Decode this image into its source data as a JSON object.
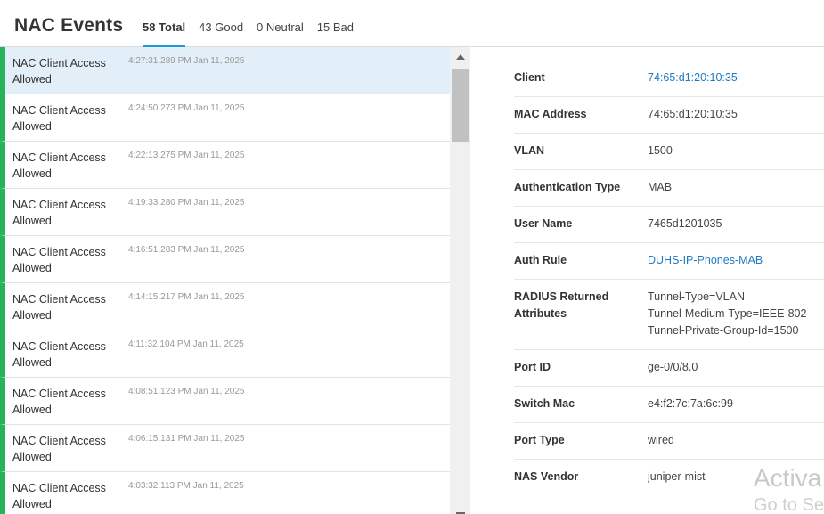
{
  "header": {
    "title": "NAC Events",
    "tabs": [
      {
        "label": "58 Total",
        "active": true
      },
      {
        "label": "43 Good",
        "active": false
      },
      {
        "label": "0 Neutral",
        "active": false
      },
      {
        "label": "15 Bad",
        "active": false
      }
    ]
  },
  "events": [
    {
      "title": "NAC Client Access Allowed",
      "time": "4:27:31.289 PM Jan 11, 2025",
      "status": "good",
      "selected": true
    },
    {
      "title": "NAC Client Access Allowed",
      "time": "4:24:50.273 PM Jan 11, 2025",
      "status": "good",
      "selected": false
    },
    {
      "title": "NAC Client Access Allowed",
      "time": "4:22:13.275 PM Jan 11, 2025",
      "status": "good",
      "selected": false
    },
    {
      "title": "NAC Client Access Allowed",
      "time": "4:19:33.280 PM Jan 11, 2025",
      "status": "good",
      "selected": false
    },
    {
      "title": "NAC Client Access Allowed",
      "time": "4:16:51.283 PM Jan 11, 2025",
      "status": "good",
      "selected": false
    },
    {
      "title": "NAC Client Access Allowed",
      "time": "4:14:15.217 PM Jan 11, 2025",
      "status": "good",
      "selected": false
    },
    {
      "title": "NAC Client Access Allowed",
      "time": "4:11:32.104 PM Jan 11, 2025",
      "status": "good",
      "selected": false
    },
    {
      "title": "NAC Client Access Allowed",
      "time": "4:08:51.123 PM Jan 11, 2025",
      "status": "good",
      "selected": false
    },
    {
      "title": "NAC Client Access Allowed",
      "time": "4:06:15.131 PM Jan 11, 2025",
      "status": "good",
      "selected": false
    },
    {
      "title": "NAC Client Access Allowed",
      "time": "4:03:32.113 PM Jan 11, 2025",
      "status": "good",
      "selected": false
    }
  ],
  "details": [
    {
      "label": "Client",
      "value": [
        "74:65:d1:20:10:35"
      ],
      "link": true
    },
    {
      "label": "MAC Address",
      "value": [
        "74:65:d1:20:10:35"
      ],
      "link": false
    },
    {
      "label": "VLAN",
      "value": [
        "1500"
      ],
      "link": false
    },
    {
      "label": "Authentication Type",
      "value": [
        "MAB"
      ],
      "link": false
    },
    {
      "label": "User Name",
      "value": [
        "7465d1201035"
      ],
      "link": false
    },
    {
      "label": "Auth Rule",
      "value": [
        "DUHS-IP-Phones-MAB"
      ],
      "link": true
    },
    {
      "label": "RADIUS Returned Attributes",
      "value": [
        "Tunnel-Type=VLAN",
        "Tunnel-Medium-Type=IEEE-802",
        "Tunnel-Private-Group-Id=1500"
      ],
      "link": false
    },
    {
      "label": "Port ID",
      "value": [
        "ge-0/0/8.0"
      ],
      "link": false
    },
    {
      "label": "Switch Mac",
      "value": [
        "e4:f2:7c:7a:6c:99"
      ],
      "link": false
    },
    {
      "label": "Port Type",
      "value": [
        "wired"
      ],
      "link": false
    },
    {
      "label": "NAS Vendor",
      "value": [
        "juniper-mist"
      ],
      "link": false
    }
  ],
  "watermark": {
    "line1": "Activa",
    "line2": "Go to Se"
  },
  "colors": {
    "good": "#27b35a",
    "accent": "#1f9ad6",
    "link": "#1f7ac2",
    "selected_row": "#e2eef8"
  }
}
